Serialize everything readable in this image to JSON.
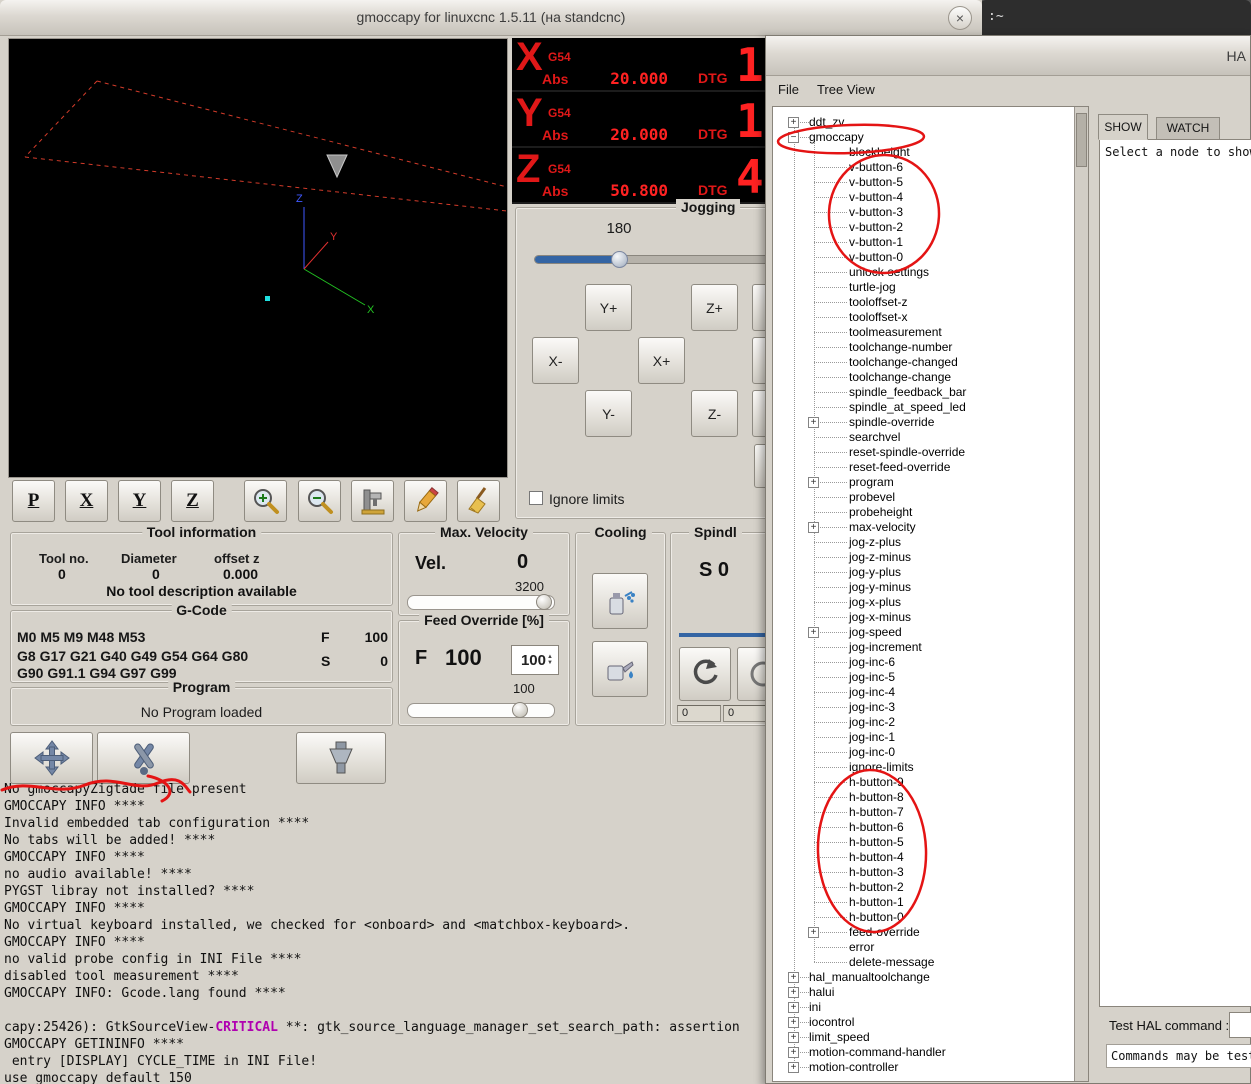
{
  "colors": {
    "accent_blue": "#3465a4",
    "dro_red": "#ff2222",
    "annotation_red": "#e41414",
    "critical_magenta": "#b000b0"
  },
  "terminal_window": {
    "title": ":~"
  },
  "main_window": {
    "title": "gmoccapy for linuxcnc  1.5.11 (на standcnc)",
    "close_label": "×",
    "dro": {
      "axes": [
        {
          "letter": "X",
          "system": "G54",
          "abs_label": "Abs",
          "abs_value": "20.000",
          "dtg_label": "DTG",
          "big_digit": "1"
        },
        {
          "letter": "Y",
          "system": "G54",
          "abs_label": "Abs",
          "abs_value": "20.000",
          "dtg_label": "DTG",
          "big_digit": "1"
        },
        {
          "letter": "Z",
          "system": "G54",
          "abs_label": "Abs",
          "abs_value": "50.800",
          "dtg_label": "DTG",
          "big_digit": "4"
        }
      ]
    },
    "preview_toolbar": {
      "letters": [
        "P",
        "X",
        "Y",
        "Z"
      ]
    },
    "jogging": {
      "title": "Jogging",
      "speed_value": "180",
      "buttons": [
        "Y+",
        "Z+",
        "X-",
        "X+",
        "Y-",
        "Z-"
      ],
      "ignore_limits_label": "Ignore limits"
    },
    "tool_info": {
      "title": "Tool information",
      "columns": [
        {
          "label": "Tool no.",
          "value": "0"
        },
        {
          "label": "Diameter",
          "value": "0"
        },
        {
          "label": "offset z",
          "value": "0.000"
        }
      ],
      "description": "No tool description available"
    },
    "gcode": {
      "title": "G-Code",
      "lines": [
        "M0 M5 M9 M48 M53",
        "G8 G17 G21 G40 G49 G54 G64 G80",
        "G90 G91.1 G94 G97 G99"
      ],
      "f_label": "F",
      "f_value": "100",
      "s_label": "S",
      "s_value": "0"
    },
    "program": {
      "title": "Program",
      "status": "No Program loaded"
    },
    "max_velocity": {
      "title": "Max. Velocity",
      "vel_label": "Vel.",
      "vel_value": "0",
      "limit_value": "3200"
    },
    "feed_override": {
      "title": "Feed Override [%]",
      "f_label": "F",
      "value": "100",
      "spin_value": "100",
      "scale_value": "100"
    },
    "cooling": {
      "title": "Cooling"
    },
    "spindle": {
      "title": "Spindl",
      "s_value": "S 0",
      "left_readout": "0",
      "right_readout": "0"
    },
    "log_lines": [
      "No gmoccapyZigtade file present",
      "GMOCCAPY INFO ****",
      "Invalid embedded tab configuration ****",
      "No tabs will be added! ****",
      "GMOCCAPY INFO ****",
      "no audio available! ****",
      "PYGST libray not installed? ****",
      "GMOCCAPY INFO ****",
      "No virtual keyboard installed, we checked for <onboard> and <matchbox-keyboard>.",
      "GMOCCAPY INFO ****",
      "no valid probe config in INI File ****",
      "disabled tool measurement ****",
      "GMOCCAPY INFO: Gcode.lang found ****",
      "",
      {
        "segments": [
          {
            "text": "capy:25426): GtkSourceView-"
          },
          {
            "text": "CRITICAL",
            "color": "#b000b0"
          },
          {
            "text": " **: gtk_source_language_manager_set_search_path: assertion"
          }
        ]
      },
      "GMOCCAPY GETININFO ****",
      " entry [DISPLAY] CYCLE_TIME in INI File!",
      "use gmoccapy default 150"
    ]
  },
  "hal_window": {
    "title": "HA",
    "menu": [
      "File",
      "Tree View"
    ],
    "tabs": [
      "SHOW",
      "WATCH"
    ],
    "show_placeholder": "Select a node to show",
    "test_command_label": "Test HAL command :",
    "commands_hint": "Commands may be test",
    "tree": [
      {
        "label": "ddt_zv",
        "depth": 0,
        "exp": "plus"
      },
      {
        "label": "gmoccapy",
        "depth": 0,
        "exp": "minus"
      },
      {
        "label": "blockheight",
        "depth": 1
      },
      {
        "label": "v-button-6",
        "depth": 1
      },
      {
        "label": "v-button-5",
        "depth": 1
      },
      {
        "label": "v-button-4",
        "depth": 1
      },
      {
        "label": "v-button-3",
        "depth": 1
      },
      {
        "label": "v-button-2",
        "depth": 1
      },
      {
        "label": "v-button-1",
        "depth": 1
      },
      {
        "label": "v-button-0",
        "depth": 1
      },
      {
        "label": "unlock-settings",
        "depth": 1
      },
      {
        "label": "turtle-jog",
        "depth": 1
      },
      {
        "label": "tooloffset-z",
        "depth": 1
      },
      {
        "label": "tooloffset-x",
        "depth": 1
      },
      {
        "label": "toolmeasurement",
        "depth": 1
      },
      {
        "label": "toolchange-number",
        "depth": 1
      },
      {
        "label": "toolchange-changed",
        "depth": 1
      },
      {
        "label": "toolchange-change",
        "depth": 1
      },
      {
        "label": "spindle_feedback_bar",
        "depth": 1
      },
      {
        "label": "spindle_at_speed_led",
        "depth": 1
      },
      {
        "label": "spindle-override",
        "depth": 1,
        "exp": "plus"
      },
      {
        "label": "searchvel",
        "depth": 1
      },
      {
        "label": "reset-spindle-override",
        "depth": 1
      },
      {
        "label": "reset-feed-override",
        "depth": 1
      },
      {
        "label": "program",
        "depth": 1,
        "exp": "plus"
      },
      {
        "label": "probevel",
        "depth": 1
      },
      {
        "label": "probeheight",
        "depth": 1
      },
      {
        "label": "max-velocity",
        "depth": 1,
        "exp": "plus"
      },
      {
        "label": "jog-z-plus",
        "depth": 1
      },
      {
        "label": "jog-z-minus",
        "depth": 1
      },
      {
        "label": "jog-y-plus",
        "depth": 1
      },
      {
        "label": "jog-y-minus",
        "depth": 1
      },
      {
        "label": "jog-x-plus",
        "depth": 1
      },
      {
        "label": "jog-x-minus",
        "depth": 1
      },
      {
        "label": "jog-speed",
        "depth": 1,
        "exp": "plus"
      },
      {
        "label": "jog-increment",
        "depth": 1
      },
      {
        "label": "jog-inc-6",
        "depth": 1
      },
      {
        "label": "jog-inc-5",
        "depth": 1
      },
      {
        "label": "jog-inc-4",
        "depth": 1
      },
      {
        "label": "jog-inc-3",
        "depth": 1
      },
      {
        "label": "jog-inc-2",
        "depth": 1
      },
      {
        "label": "jog-inc-1",
        "depth": 1
      },
      {
        "label": "jog-inc-0",
        "depth": 1
      },
      {
        "label": "ignore-limits",
        "depth": 1
      },
      {
        "label": "h-button-9",
        "depth": 1
      },
      {
        "label": "h-button-8",
        "depth": 1
      },
      {
        "label": "h-button-7",
        "depth": 1
      },
      {
        "label": "h-button-6",
        "depth": 1
      },
      {
        "label": "h-button-5",
        "depth": 1
      },
      {
        "label": "h-button-4",
        "depth": 1
      },
      {
        "label": "h-button-3",
        "depth": 1
      },
      {
        "label": "h-button-2",
        "depth": 1
      },
      {
        "label": "h-button-1",
        "depth": 1
      },
      {
        "label": "h-button-0",
        "depth": 1
      },
      {
        "label": "feed-override",
        "depth": 1,
        "exp": "plus"
      },
      {
        "label": "error",
        "depth": 1
      },
      {
        "label": "delete-message",
        "depth": 1
      },
      {
        "label": "hal_manualtoolchange",
        "depth": 0,
        "exp": "plus"
      },
      {
        "label": "halui",
        "depth": 0,
        "exp": "plus"
      },
      {
        "label": "ini",
        "depth": 0,
        "exp": "plus"
      },
      {
        "label": "iocontrol",
        "depth": 0,
        "exp": "plus"
      },
      {
        "label": "limit_speed",
        "depth": 0,
        "exp": "plus"
      },
      {
        "label": "motion-command-handler",
        "depth": 0,
        "exp": "plus"
      },
      {
        "label": "motion-controller",
        "depth": 0,
        "exp": "plus"
      }
    ]
  }
}
